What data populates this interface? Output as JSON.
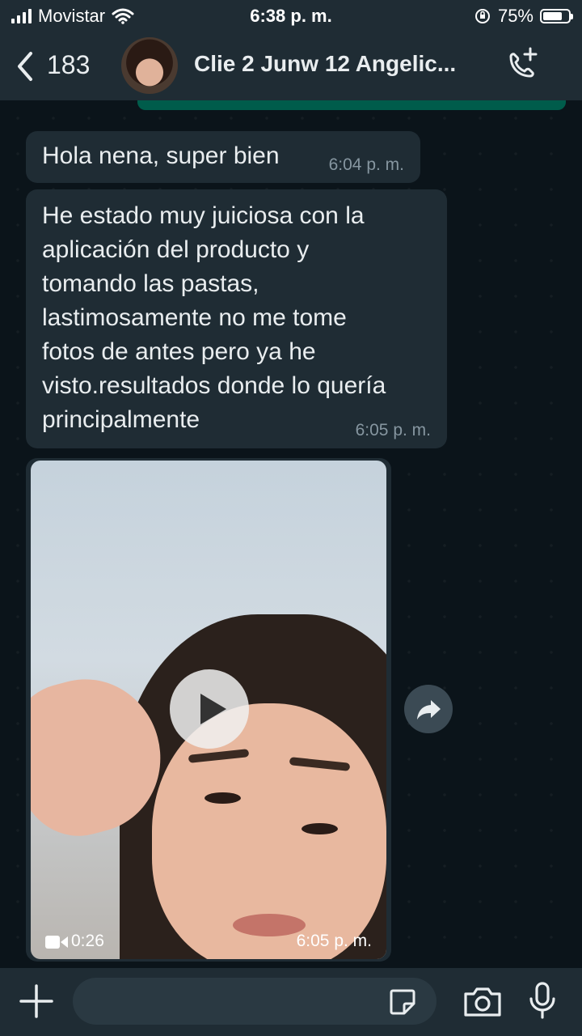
{
  "status_bar": {
    "carrier": "Movistar",
    "time": "6:38 p. m.",
    "battery_percent": "75%",
    "battery_level": 0.75,
    "icons": [
      "signal-icon",
      "wifi-icon",
      "orientation-lock-icon",
      "battery-icon"
    ]
  },
  "header": {
    "back_count": "183",
    "title": "Clie 2 Junw 12 Angelic...",
    "icons": [
      "back-chevron-icon",
      "avatar",
      "add-call-icon"
    ]
  },
  "messages": [
    {
      "type": "text",
      "direction": "incoming",
      "text": "Hola nena, super bien",
      "time": "6:04 p. m."
    },
    {
      "type": "text",
      "direction": "incoming",
      "lines": [
        "He estado muy juiciosa con la",
        "aplicación del producto y",
        "tomando las pastas,",
        "lastimosamente no me tome",
        "fotos de antes pero ya he",
        "visto.resultados donde lo quería",
        "principalmente"
      ],
      "time": "6:05 p. m."
    },
    {
      "type": "video",
      "direction": "incoming",
      "duration": "0:26",
      "time": "6:05 p. m."
    }
  ],
  "input_bar": {
    "placeholder": "",
    "icons": [
      "plus-icon",
      "sticker-icon",
      "camera-icon",
      "mic-icon"
    ]
  },
  "colors": {
    "bar_bg": "#1f2c34",
    "chat_bg": "#0b141a",
    "incoming_bubble": "#1f2c34",
    "outgoing_bubble": "#005c4b",
    "meta_text": "#8696a0"
  }
}
